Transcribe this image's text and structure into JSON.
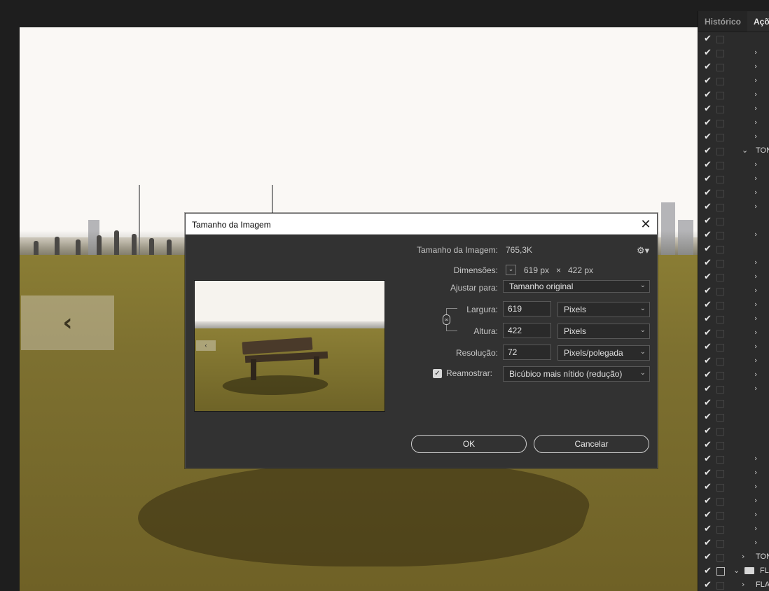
{
  "panel": {
    "tabs": [
      "Histórico",
      "Açõ"
    ],
    "group_labels": [
      "TON",
      "TON",
      "FL",
      "FLA"
    ]
  },
  "canvas": {
    "nav_prev_icon": "chevron-left-icon"
  },
  "dialog": {
    "title": "Tamanho da Imagem",
    "close_icon": "close-icon",
    "image_size_label": "Tamanho da Imagem:",
    "image_size_value": "765,3K",
    "settings_icon": "gear-icon",
    "dimensions_label": "Dimensões:",
    "dimensions_width": "619 px",
    "dimensions_times": "×",
    "dimensions_height": "422 px",
    "fit_to_label": "Ajustar para:",
    "fit_to_value": "Tamanho original",
    "width_label": "Largura:",
    "width_value": "619",
    "width_unit": "Pixels",
    "height_label": "Altura:",
    "height_value": "422",
    "height_unit": "Pixels",
    "resolution_label": "Resolução:",
    "resolution_value": "72",
    "resolution_unit": "Pixels/polegada",
    "resample_label": "Reamostrar:",
    "resample_checked": true,
    "resample_value": "Bicúbico mais nítido (redução)",
    "ok_label": "OK",
    "cancel_label": "Cancelar"
  }
}
